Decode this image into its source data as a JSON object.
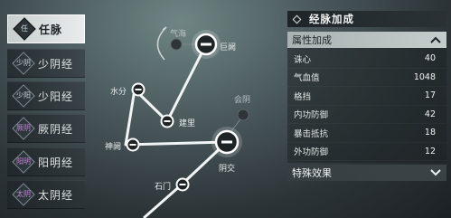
{
  "sidebar": {
    "items": [
      {
        "badge": "任",
        "label": "任脉",
        "active": true,
        "badge_color": "gray"
      },
      {
        "badge": "少阴",
        "label": "少阴经",
        "active": false,
        "badge_color": "gray"
      },
      {
        "badge": "少阳",
        "label": "少阳经",
        "active": false,
        "badge_color": "gray"
      },
      {
        "badge": "厥阴",
        "label": "厥阴经",
        "active": false,
        "badge_color": "purple"
      },
      {
        "badge": "阳明",
        "label": "阳明经",
        "active": false,
        "badge_color": "purple"
      },
      {
        "badge": "太阴",
        "label": "太阴经",
        "active": false,
        "badge_color": "purple"
      }
    ]
  },
  "map": {
    "points": {
      "qihai": "气海",
      "juque": "巨阙",
      "shuifen": "水分",
      "jianli": "建里",
      "shenque": "神阙",
      "huiyin": "会阴",
      "yinjiao": "阴交",
      "shimen": "石门"
    }
  },
  "panel": {
    "title": "经脉加成",
    "attributes_header": "属性加成",
    "attributes": [
      {
        "name": "诛心",
        "value": "40"
      },
      {
        "name": "气血值",
        "value": "1048"
      },
      {
        "name": "格挡",
        "value": "17"
      },
      {
        "name": "内功防御",
        "value": "42"
      },
      {
        "name": "暴击抵抗",
        "value": "18"
      },
      {
        "name": "外功防御",
        "value": "12"
      }
    ],
    "special_header": "特殊效果"
  },
  "colors": {
    "active_tab": "#e0e4e4",
    "section_header": "#b8c0c0",
    "purple_badge": "#c58ad8"
  }
}
